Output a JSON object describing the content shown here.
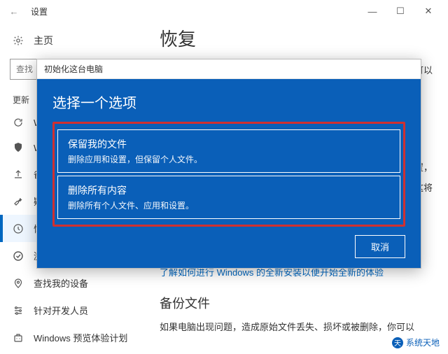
{
  "window": {
    "title": "设置",
    "back_icon": "←",
    "minimize": "—",
    "maximize": "☐",
    "close": "✕"
  },
  "sidebar": {
    "home_label": "主页",
    "search_placeholder": "查找",
    "group_label": "更新",
    "items": [
      {
        "label": "W",
        "icon": "sync"
      },
      {
        "label": "W",
        "icon": "shield"
      },
      {
        "label": "备",
        "icon": "upload"
      },
      {
        "label": "疑",
        "icon": "wrench"
      },
      {
        "label": "恢",
        "icon": "history",
        "active": true
      },
      {
        "label": "激",
        "icon": "check"
      },
      {
        "label": "查找我的设备",
        "icon": "location"
      },
      {
        "label": "针对开发人员",
        "icon": "sliders"
      },
      {
        "label": "Windows 预览体验计划",
        "icon": "insider"
      }
    ]
  },
  "main": {
    "page_title": "恢复",
    "partial_right_1": "可以",
    "partial_right_2": "置，",
    "partial_right_3": "这将",
    "link_text": "了解如何进行 Windows 的全新安装以便开始全新的体验",
    "section_h": "备份文件",
    "body_text": "如果电脑出现问题，造成原始文件丢失、损坏或被删除，你可以"
  },
  "dialog": {
    "header": "初始化这台电脑",
    "title": "选择一个选项",
    "options": [
      {
        "title": "保留我的文件",
        "desc": "删除应用和设置，但保留个人文件。"
      },
      {
        "title": "删除所有内容",
        "desc": "删除所有个人文件、应用和设置。"
      }
    ],
    "cancel": "取消"
  },
  "watermark": "系统天地"
}
